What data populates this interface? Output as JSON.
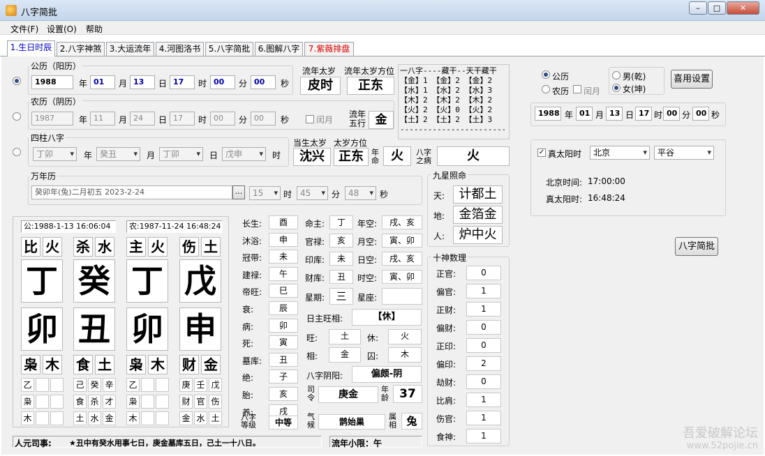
{
  "window": {
    "title": "八字简批"
  },
  "menu": [
    "文件(F)",
    "设置(O)",
    "帮助"
  ],
  "tabs": [
    "1.生日时辰",
    "2.八字神煞",
    "3.大运流年",
    "4.河图洛书",
    "5.八字简批",
    "6.图解八字",
    "7.紫薇排盘"
  ],
  "solar": {
    "group": "公历（阳历）",
    "year": "1988",
    "month": "01",
    "day": "13",
    "hour": "17",
    "minute": "00",
    "second": "00"
  },
  "lunar": {
    "group": "农历（阴历）",
    "year": "1987",
    "month": "11",
    "day": "24",
    "hour": "17",
    "minute": "00",
    "second": "00",
    "leap": "闰月"
  },
  "units": {
    "year": "年",
    "month": "月",
    "day": "日",
    "hour": "时",
    "minute": "分",
    "second": "秒"
  },
  "pillars": {
    "group": "四柱八字",
    "year": "丁卯",
    "month": "癸丑",
    "day": "丁卯",
    "hour": "戊申",
    "l_year": "年",
    "l_month": "月",
    "l_day": "日",
    "l_hour": "时"
  },
  "taisui": {
    "liunian_label": "流年太岁",
    "liunian": "皮时",
    "fangwei_label": "流年太岁方位",
    "fangwei": "正东",
    "wuxing_label": "流年五行",
    "wuxing": "金",
    "dangsheng_label": "当生太岁",
    "dangsheng": "沈兴",
    "dangsheng_fw_label": "太岁方位",
    "dangsheng_fw": "正东",
    "nianming_label": "年命",
    "nianming": "火",
    "zhibing_label": "八字之病",
    "zhibing": "火"
  },
  "canggan": [
    "一八字----藏干--天干藏干",
    "【金】1 【金】2 【金】2",
    "【水】1 【水】2 【水】3",
    "【木】2 【木】2 【木】2",
    "【火】2 【火】0 【火】2",
    "【土】2 【土】2 【土】3",
    "---------------------------"
  ],
  "wannianli": {
    "group": "万年历",
    "date": "癸卯年(兔)二月初五  2023-2-24",
    "hour": "15",
    "minute": "45",
    "second": "48",
    "ellipsis": "..."
  },
  "calendar": {
    "solar": "公历",
    "lunar": "农历",
    "male": "男(乾)",
    "female": "女(坤)",
    "leap": "闰月",
    "save": "喜用设置",
    "year": "1988",
    "month": "01",
    "day": "13",
    "hour": "17",
    "minute": "00",
    "second": "00"
  },
  "truesun": {
    "label": "真太阳时",
    "province": "北京",
    "city": "平谷",
    "bj_label": "北京时间:",
    "bj_time": "17:00:00",
    "ts_label": "真太阳时:",
    "ts_time": "16:48:24"
  },
  "jianpi_button": "八字简批",
  "chart": {
    "solar": "公:1988-1-13 16:06:04",
    "lunar": "农:1987-11-24 16:48:24",
    "cols": [
      {
        "s1": "比",
        "s2": "火",
        "top": "丁",
        "bottom": "卯",
        "b1": "枭",
        "b2": "木",
        "h": [
          "乙",
          "",
          ""
        ],
        "g": [
          "枭",
          "",
          ""
        ],
        "w": [
          "木",
          "",
          ""
        ]
      },
      {
        "s1": "杀",
        "s2": "水",
        "top": "癸",
        "bottom": "丑",
        "b1": "食",
        "b2": "土",
        "h": [
          "己",
          "癸",
          "辛"
        ],
        "g": [
          "食",
          "杀",
          "才"
        ],
        "w": [
          "土",
          "水",
          "金"
        ]
      },
      {
        "s1": "主",
        "s2": "火",
        "top": "丁",
        "bottom": "卯",
        "b1": "枭",
        "b2": "木",
        "h": [
          "乙",
          "",
          ""
        ],
        "g": [
          "枭",
          "",
          ""
        ],
        "w": [
          "木",
          "",
          ""
        ]
      },
      {
        "s1": "伤",
        "s2": "土",
        "top": "戊",
        "bottom": "申",
        "b1": "财",
        "b2": "金",
        "h": [
          "庚",
          "壬",
          "戊"
        ],
        "g": [
          "财",
          "官",
          "伤"
        ],
        "w": [
          "金",
          "水",
          "土"
        ]
      }
    ]
  },
  "changsheng": [
    [
      "长生:",
      "酉"
    ],
    [
      "沐浴:",
      "申"
    ],
    [
      "冠带:",
      "未"
    ],
    [
      "建禄:",
      "午"
    ],
    [
      "帝旺:",
      "巳"
    ],
    [
      "衰:",
      "辰"
    ],
    [
      "病:",
      "卯"
    ],
    [
      "死:",
      "寅"
    ],
    [
      "墓库:",
      "丑"
    ],
    [
      "绝:",
      "子"
    ],
    [
      "胎:",
      "亥"
    ],
    [
      "养:",
      "戌"
    ]
  ],
  "bazi_grade": {
    "label": "八字等级",
    "value": "中等"
  },
  "info": {
    "mingzhu_l": "命主:",
    "mingzhu": "丁",
    "niankong_l": "年空:",
    "niankong": "戌、亥",
    "guanlu_l": "官禄:",
    "guanlu": "亥",
    "yuekong_l": "月空:",
    "yuekong": "寅、卯",
    "yinku_l": "印库:",
    "yinku": "未",
    "rikong_l": "日空:",
    "rikong": "戌、亥",
    "caiku_l": "财库:",
    "caiku": "丑",
    "shikong_l": "时空:",
    "shikong": "寅、卯",
    "xingqi_l": "星期:",
    "xingqi": "三",
    "xingzuo_l": "星座:",
    "xingzuo": "",
    "wangxiang_l": "日主旺相:",
    "wangxiang": "【休】",
    "wang_l": "旺:",
    "wang": "土",
    "xiu_l": "休:",
    "xiu": "火",
    "xiang_l": "相:",
    "xiang": "金",
    "qiu_l": "囚:",
    "qiu": "木",
    "yinyang_l": "八字阴阳:",
    "yinyang": "偏颇-阴",
    "siling_l": "司令",
    "siling": "庚金",
    "nianling_l": "年龄",
    "nianling": "37",
    "qihou_l": "气候",
    "qihou": "鹊始巢",
    "shuxiang_l": "属相",
    "shuxiang": "兔"
  },
  "jiuxing": {
    "group": "九星照命",
    "tian_l": "天:",
    "tian": "计都土",
    "di_l": "地:",
    "di": "金箔金",
    "ren_l": "人:",
    "ren": "炉中火"
  },
  "shishen": {
    "group": "十神数理",
    "items": [
      [
        "正官:",
        "0"
      ],
      [
        "偏官:",
        "1"
      ],
      [
        "正财:",
        "1"
      ],
      [
        "偏财:",
        "0"
      ],
      [
        "正印:",
        "0"
      ],
      [
        "偏印:",
        "2"
      ],
      [
        "劫财:",
        "0"
      ],
      [
        "比肩:",
        "1"
      ],
      [
        "伤官:",
        "1"
      ],
      [
        "食神:",
        "1"
      ]
    ]
  },
  "status": {
    "renyuan_l": "人元司事:",
    "renyuan": "★丑中有癸水用事七日，庚金墓库五日，己土一十八日。",
    "xiaoxian": "流年小限：午"
  },
  "watermark": {
    "line1": "吾爱破解论坛",
    "line2": "www.52pojie.cn"
  }
}
